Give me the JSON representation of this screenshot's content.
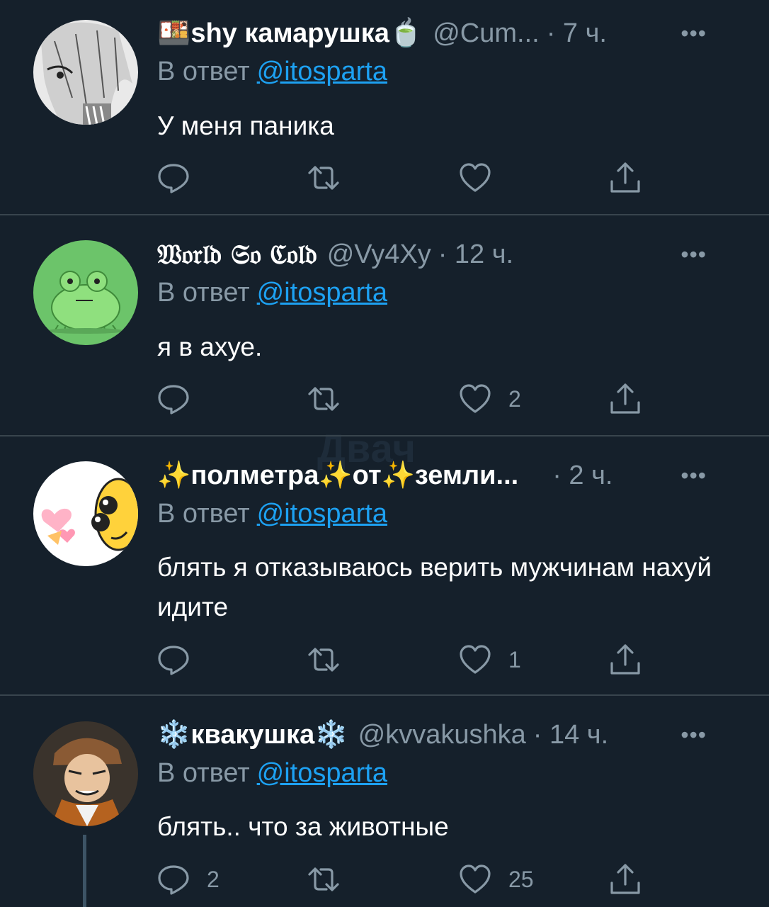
{
  "watermark": "Двач",
  "tweets": [
    {
      "name": "🍱shy камарушка🍵",
      "handle": "@Cum...",
      "time": "· 7 ч.",
      "more": "•••",
      "reply_label": "В ответ",
      "reply_mention": "@itosparta",
      "text": "У меня паника",
      "reply_count": "",
      "retweet_count": "",
      "like_count": "",
      "avatar": "anime-girl-avatar"
    },
    {
      "name": "𝔚𝔬𝔯𝔩𝔡 𝔖𝔬 ℭ𝔬𝔩𝔡",
      "handle": "@Vy4Xy",
      "time": "· 12 ч.",
      "more": "•••",
      "reply_label": "В ответ",
      "reply_mention": "@itosparta",
      "text": "я в ахуе.",
      "reply_count": "",
      "retweet_count": "",
      "like_count": "2",
      "avatar": "green-frog-avatar"
    },
    {
      "name": "✨полметра✨от✨земли...",
      "handle": "",
      "time": "· 2 ч.",
      "more": "•••",
      "reply_label": "В ответ",
      "reply_mention": "@itosparta",
      "text": "блять я отказываюсь верить мужчинам нахуй идите",
      "reply_count": "",
      "retweet_count": "",
      "like_count": "1",
      "avatar": "yellow-cartoon-avatar"
    },
    {
      "name": "❄️квакушка❄️",
      "handle": "@kvvakushka",
      "time": "· 14 ч.",
      "more": "•••",
      "reply_label": "В ответ",
      "reply_mention": "@itosparta",
      "text": "блять.. что за животные",
      "reply_count": "2",
      "retweet_count": "",
      "like_count": "25",
      "avatar": "anime-boy-avatar"
    }
  ],
  "colors": {
    "background": "#15202b",
    "secondary_text": "#8899a6",
    "link": "#1da1f2",
    "divider": "#38444d"
  }
}
